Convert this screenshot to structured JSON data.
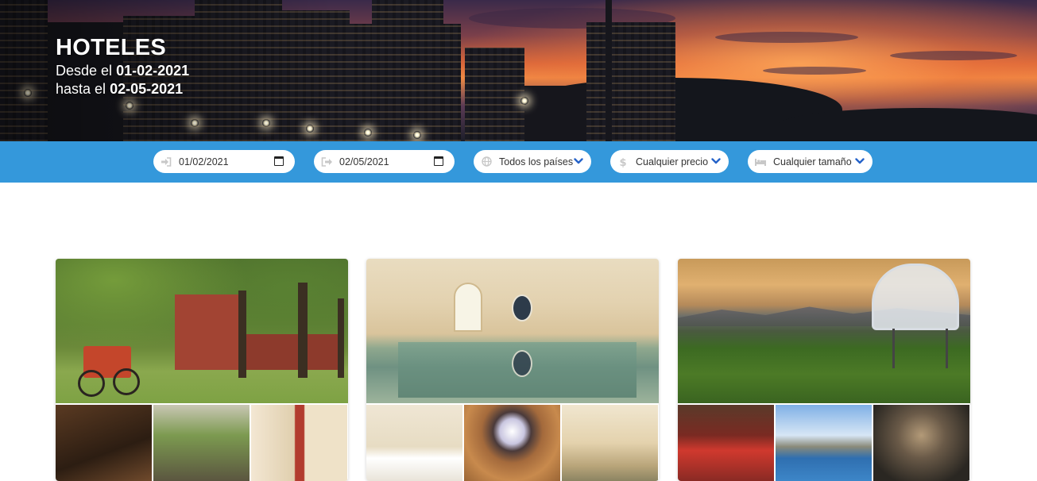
{
  "hero": {
    "title": "HOTELES",
    "from_prefix": "Desde el",
    "from_date": "01-02-2021",
    "to_prefix": "hasta el",
    "to_date": "02-05-2021"
  },
  "filters": {
    "check_in": {
      "value": "01/02/2021",
      "icon": "sign-in-icon"
    },
    "check_out": {
      "value": "02/05/2021",
      "icon": "sign-out-icon"
    },
    "country": {
      "selected": "Todos los países",
      "icon": "globe-icon"
    },
    "price": {
      "selected": "Cualquier precio",
      "icon": "dollar-icon"
    },
    "size": {
      "selected": "Cualquier tamaño",
      "icon": "bed-icon"
    }
  },
  "colors": {
    "filter_bar": "#3498db",
    "chevron": "#2563c9",
    "icon_muted": "#c8c8c8"
  }
}
